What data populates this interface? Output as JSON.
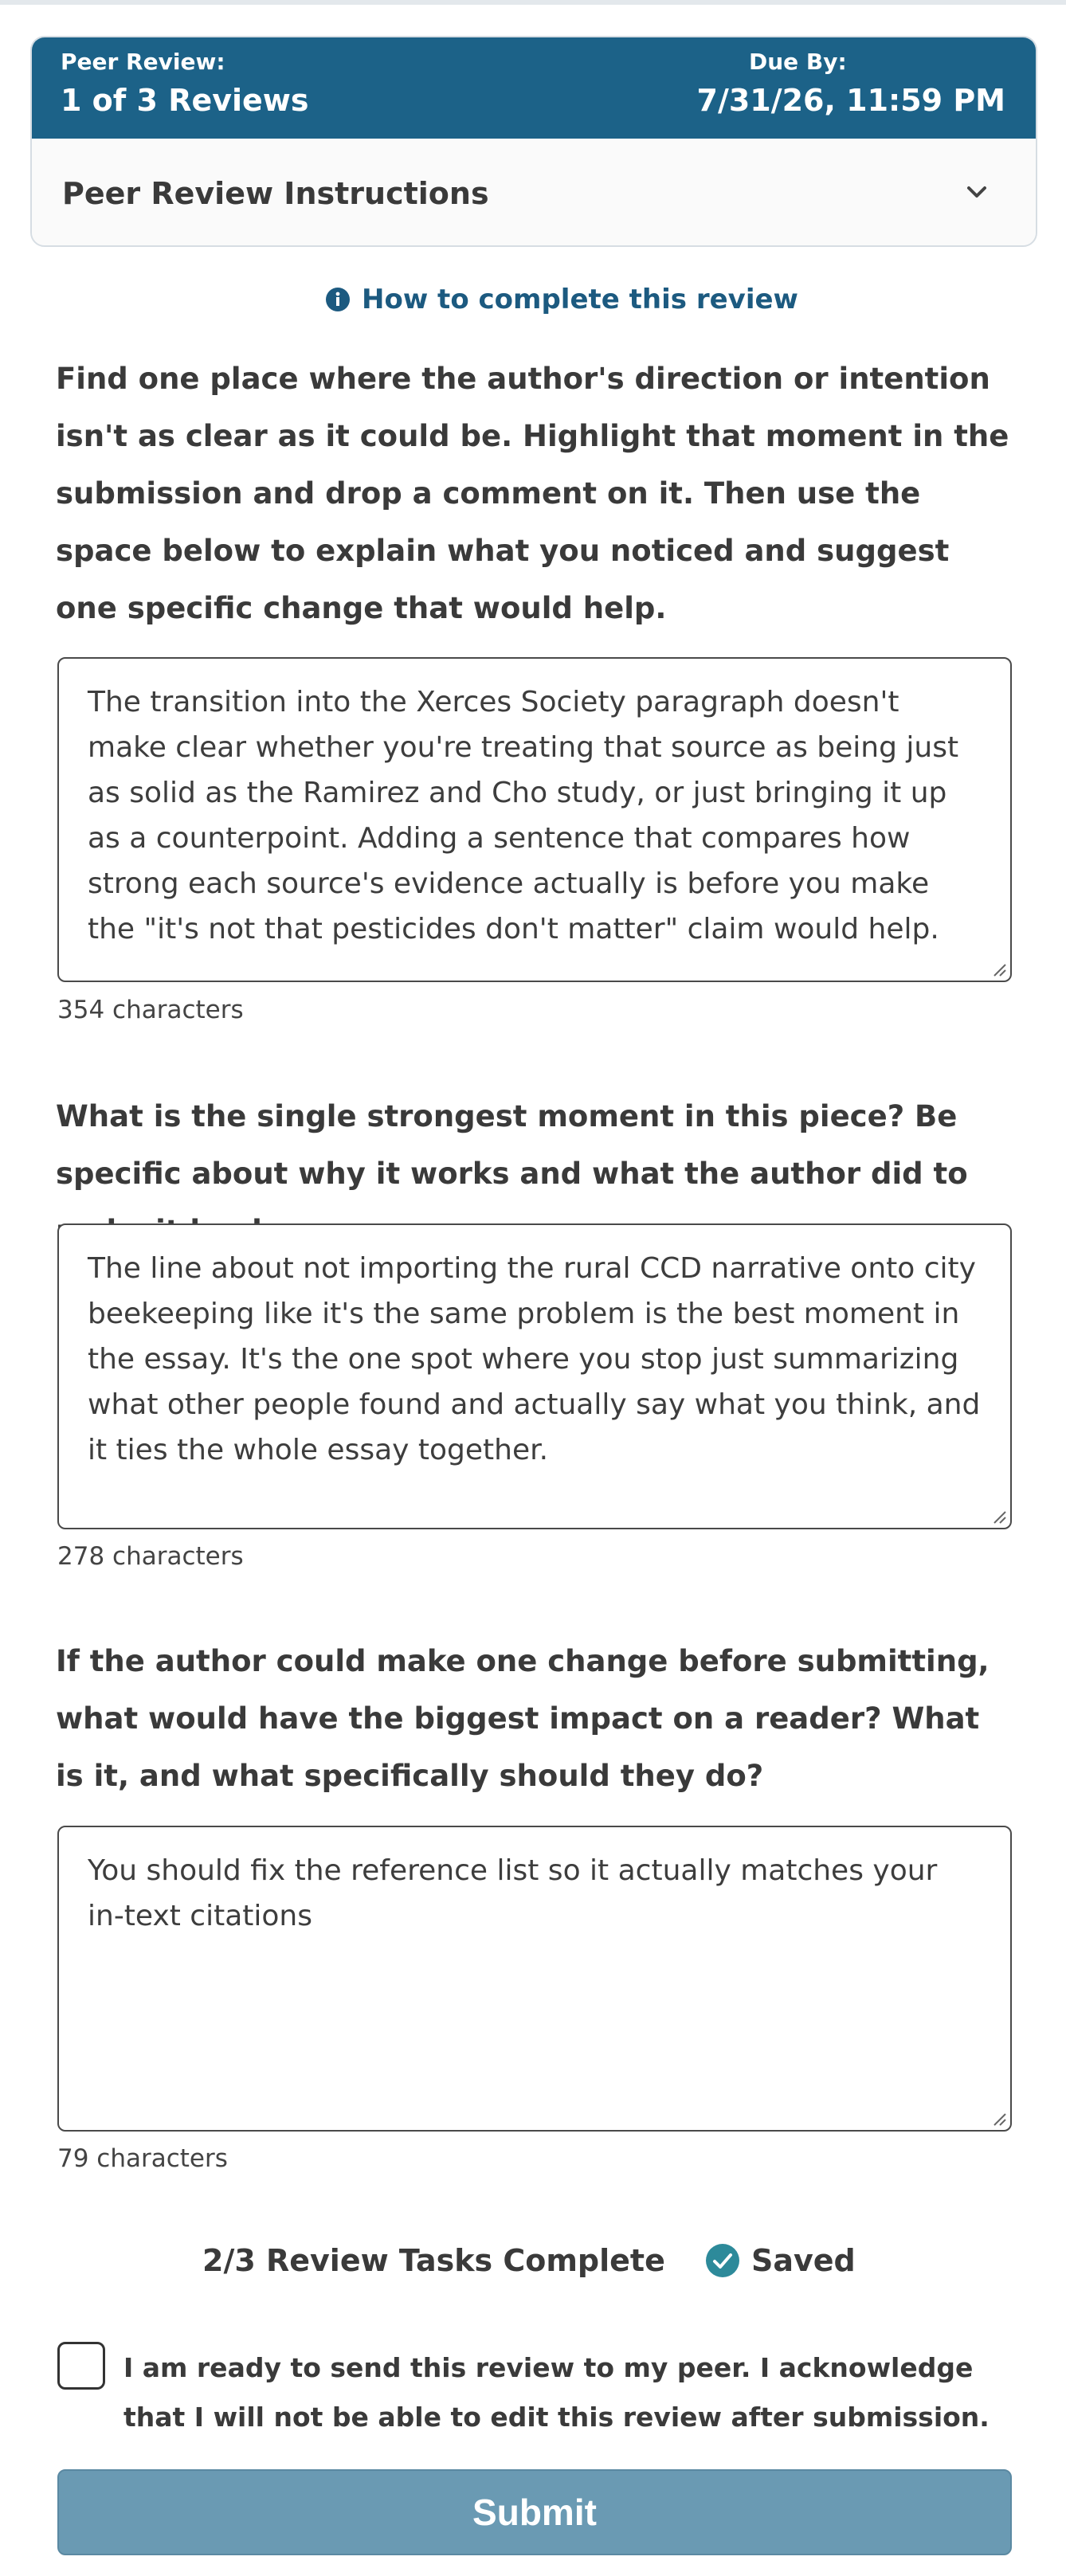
{
  "header": {
    "review_label": "Peer Review:",
    "review_value": "1 of 3 Reviews",
    "due_label": "Due By:",
    "due_value": "7/31/26, 11:59 PM",
    "instructions_label": "Peer Review Instructions"
  },
  "help_link": "How to complete this review",
  "questions": [
    {
      "prompt": "Find one place where the author's direction or intention isn't as clear as it could be. Highlight that moment in the submission and drop a comment on it. Then use the space below to explain what you noticed and suggest one specific change that would help.",
      "answer": "The transition into the Xerces Society paragraph doesn't make clear whether you're treating that source as being just as solid as the Ramirez and Cho study, or just bringing it up as a counterpoint. Adding a sentence that compares how strong each source's evidence actually is before you make the \"it's not that pesticides don't matter\" claim would help.",
      "count": "354 characters"
    },
    {
      "prompt": "What is the single strongest moment in this piece? Be specific about why it works and what the author did to make it land.",
      "answer": "The line about not importing the rural CCD narrative onto city beekeeping like it's the same problem is the best moment in the essay. It's the one spot where you stop just summarizing what other people found and actually say what you think, and it ties the whole essay together.",
      "count": "278 characters"
    },
    {
      "prompt": "If the author could make one change before submitting, what would have the biggest impact on a reader? What is it, and what specifically should they do?",
      "answer": "You should fix the reference list so it actually matches your in-text citations",
      "count": "79 characters"
    }
  ],
  "status": {
    "tasks": "2/3 Review Tasks Complete",
    "saved": "Saved"
  },
  "acknowledgement": "I am ready to send this review to my peer. I acknowledge that I will not be able to edit this review after submission.",
  "submit_label": "Submit",
  "colors": {
    "header_bg": "#1c6288",
    "link": "#1c5a80",
    "saved_check": "#2d8a9a",
    "submit_bg": "#6a9ab3"
  }
}
